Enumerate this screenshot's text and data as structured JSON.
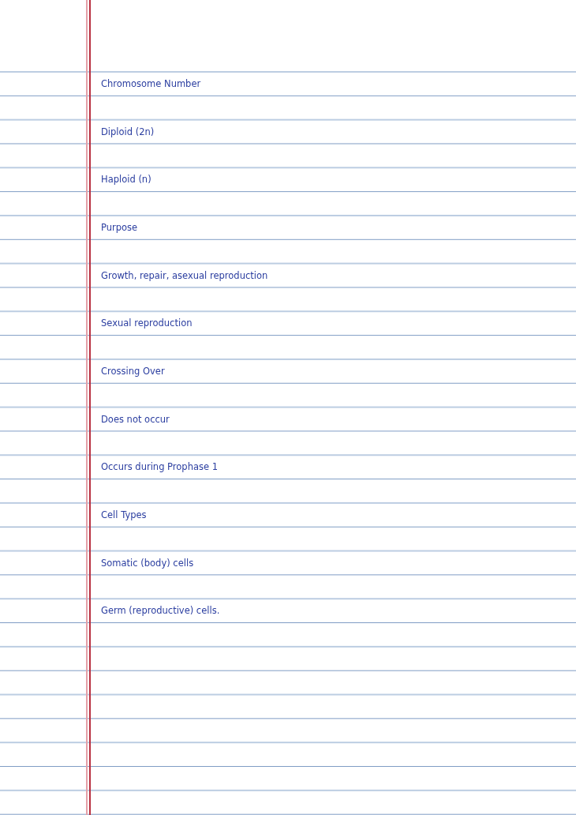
{
  "notes": [
    {
      "text": "Chromosome Number"
    },
    {
      "text": "Diploid (2n)"
    },
    {
      "text": "Haploid (n)"
    },
    {
      "text": "Purpose"
    },
    {
      "text": "Growth, repair, asexual reproduction"
    },
    {
      "text": "Sexual reproduction"
    },
    {
      "text": "Crossing Over"
    },
    {
      "text": "Does not occur"
    },
    {
      "text": "Occurs during Prophase 1"
    },
    {
      "text": "Cell Types"
    },
    {
      "text": "Somatic (body) cells"
    },
    {
      "text": "Germ (reproductive) cells."
    }
  ]
}
